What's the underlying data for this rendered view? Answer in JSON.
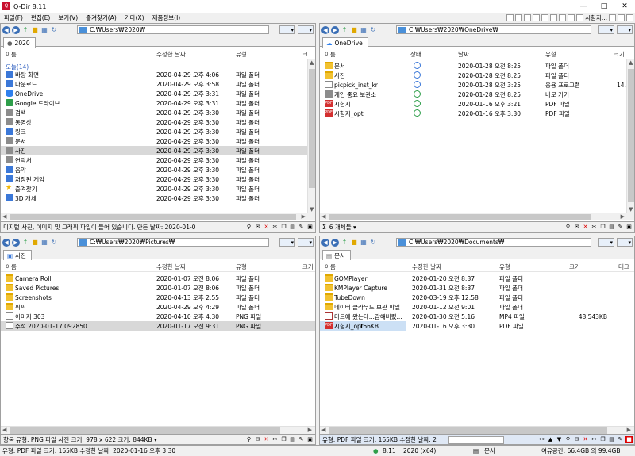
{
  "app": {
    "title": "Q-Dir 8.11",
    "icon_text": "Q"
  },
  "window_controls": [
    "—",
    "□",
    "✕"
  ],
  "menu": [
    "파일(F)",
    "편집(E)",
    "보기(V)",
    "즐겨찾기(A)",
    "기타(X)",
    "제품정보(I)"
  ],
  "menu_right": {
    "user_label": "시험지..."
  },
  "columns": {
    "name": "이름",
    "modified": "수정한 날짜",
    "type": "유형",
    "size": "크기",
    "status": "상태",
    "date": "날짜",
    "tag": "태그",
    "trailing": "크"
  },
  "panes": {
    "top_left": {
      "address": "C:₩Users₩2020₩",
      "tab": "2020",
      "group": "오늘(14)",
      "col3_trunc": "크",
      "rows": [
        {
          "name": "바탕 화면",
          "modified": "2020-04-29 오후 4:06",
          "type": "파일 폴더",
          "icon": "blue"
        },
        {
          "name": "다운로드",
          "modified": "2020-04-29 오후 3:58",
          "type": "파일 폴더",
          "icon": "blue"
        },
        {
          "name": "OneDrive",
          "modified": "2020-04-29 오후 3:31",
          "type": "파일 폴더",
          "icon": "cloud"
        },
        {
          "name": "Google 드라이브",
          "modified": "2020-04-29 오후 3:31",
          "type": "파일 폴더",
          "icon": "green"
        },
        {
          "name": "검색",
          "modified": "2020-04-29 오후 3:30",
          "type": "파일 폴더",
          "icon": "gray"
        },
        {
          "name": "동영상",
          "modified": "2020-04-29 오후 3:30",
          "type": "파일 폴더",
          "icon": "gray"
        },
        {
          "name": "링크",
          "modified": "2020-04-29 오후 3:30",
          "type": "파일 폴더",
          "icon": "blue"
        },
        {
          "name": "문서",
          "modified": "2020-04-29 오후 3:30",
          "type": "파일 폴더",
          "icon": "gray"
        },
        {
          "name": "사진",
          "modified": "2020-04-29 오후 3:30",
          "type": "파일 폴더",
          "icon": "gray",
          "selected": true
        },
        {
          "name": "연락처",
          "modified": "2020-04-29 오후 3:30",
          "type": "파일 폴더",
          "icon": "gray"
        },
        {
          "name": "음악",
          "modified": "2020-04-29 오후 3:30",
          "type": "파일 폴더",
          "icon": "blue"
        },
        {
          "name": "저장된 게임",
          "modified": "2020-04-29 오후 3:30",
          "type": "파일 폴더",
          "icon": "blue"
        },
        {
          "name": "즐겨찾기",
          "modified": "2020-04-29 오후 3:30",
          "type": "파일 폴더",
          "icon": "star"
        },
        {
          "name": "3D 개체",
          "modified": "2020-04-29 오후 3:30",
          "type": "파일 폴더",
          "icon": "blue"
        }
      ],
      "status": "디지털 사진, 이미지 및 그래픽 파일이 들어 있습니다. 만든 날짜: 2020-01-0"
    },
    "top_right": {
      "address": "C:₩Users₩2020₩OneDrive₩",
      "tab": "OneDrive",
      "rows": [
        {
          "name": "문서",
          "status": "cloud",
          "date": "2020-01-28 오전 8:25",
          "type": "파일 폴더",
          "size": "",
          "icon": "folder"
        },
        {
          "name": "사진",
          "status": "cloud",
          "date": "2020-01-28 오전 8:25",
          "type": "파일 폴더",
          "size": "",
          "icon": "folder"
        },
        {
          "name": "picpick_inst_kr",
          "status": "cloud",
          "date": "2020-01-28 오전 3:25",
          "type": "응용 프로그램",
          "size": "14,",
          "icon": "png"
        },
        {
          "name": "개인 중요 보관소",
          "status": "ok",
          "date": "2020-01-28 오전 8:25",
          "type": "바로 가기",
          "size": "",
          "icon": "gray"
        },
        {
          "name": "시험지",
          "status": "ok",
          "date": "2020-01-16 오후 3:21",
          "type": "PDF 파일",
          "size": "",
          "icon": "pdf"
        },
        {
          "name": "시험지_opt",
          "status": "ok",
          "date": "2020-01-16 오후 3:30",
          "type": "PDF 파일",
          "size": "",
          "icon": "pdf"
        }
      ],
      "status": "6 개체들 ▾"
    },
    "bottom_left": {
      "address": "C:₩Users₩2020₩Pictures₩",
      "tab": "사진",
      "rows": [
        {
          "name": "Camera Roll",
          "modified": "2020-01-07 오전 8:06",
          "type": "파일 폴더",
          "icon": "folder"
        },
        {
          "name": "Saved Pictures",
          "modified": "2020-01-07 오전 8:06",
          "type": "파일 폴더",
          "icon": "folder"
        },
        {
          "name": "Screenshots",
          "modified": "2020-04-13 오후 2:55",
          "type": "파일 폴더",
          "icon": "folder"
        },
        {
          "name": "픽픽",
          "modified": "2020-04-29 오후 4:29",
          "type": "파일 폴더",
          "icon": "folder"
        },
        {
          "name": "이미지 303",
          "modified": "2020-04-10 오후 4:30",
          "type": "PNG 파일",
          "icon": "png"
        },
        {
          "name": "주석 2020-01-17 092850",
          "modified": "2020-01-17 오전 9:31",
          "type": "PNG 파일",
          "icon": "png",
          "selected": true
        }
      ],
      "status": "항목 유형: PNG 파일 사진 크기: 978 x 622 크기: 844KB ▾"
    },
    "bottom_right": {
      "address": "C:₩Users₩2020₩Documents₩",
      "tab": "문서",
      "rows": [
        {
          "name": "GOMPlayer",
          "modified": "2020-01-20 오전 8:37",
          "type": "파일 폴더",
          "size": "",
          "icon": "folder"
        },
        {
          "name": "KMPlayer Capture",
          "modified": "2020-01-31 오전 8:37",
          "type": "파일 폴더",
          "size": "",
          "icon": "folder"
        },
        {
          "name": "TubeDown",
          "modified": "2020-03-19 오후 12:58",
          "type": "파일 폴더",
          "size": "",
          "icon": "folder"
        },
        {
          "name": "네이버 클라우드 보관 파일",
          "modified": "2020-01-12 오전 9:01",
          "type": "파일 폴더",
          "size": "",
          "icon": "folder"
        },
        {
          "name": "마트에 왔는데...감해버렸...",
          "modified": "2020-01-30 오전 5:16",
          "type": "MP4 파일",
          "size": "48,543KB",
          "icon": "mp4"
        },
        {
          "name": "시험지_opt",
          "modified": "2020-01-16 오후 3:30",
          "type": "PDF 파일",
          "size": "166KB",
          "icon": "pdf",
          "selected": true
        }
      ],
      "status": "유형: PDF 파일 크기: 165KB 수정한 날짜: 2"
    }
  },
  "bottom_status": {
    "left": "유형: PDF 파일 크기: 165KB 수정한 날짜: 2020-01-16 오후 3:30",
    "version": "8.11",
    "arch": "2020 (x64)",
    "folder": "문서",
    "free": "여유공간: 66.4GB 의 99.4GB"
  }
}
